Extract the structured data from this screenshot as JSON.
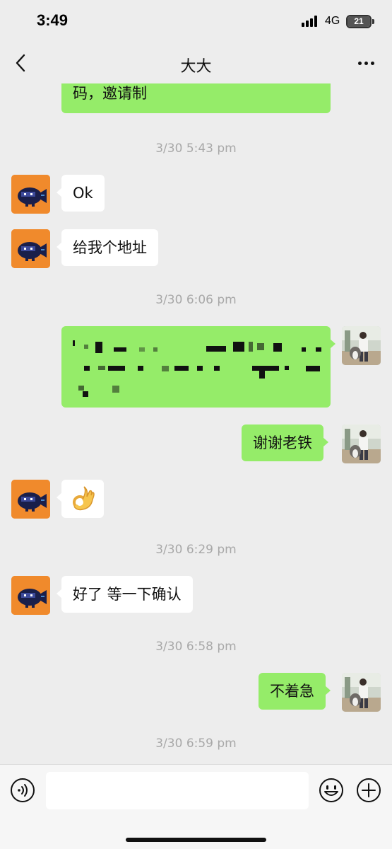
{
  "status": {
    "time": "3:49",
    "network": "4G",
    "battery": "21"
  },
  "header": {
    "title": "大大"
  },
  "messages": {
    "m1": "码，邀请制",
    "t1": "3/30 5:43 pm",
    "m2": "Ok",
    "m3": "给我个地址",
    "t2": "3/30 6:06 pm",
    "m5": "谢谢老铁",
    "t3": "3/30 6:29 pm",
    "m7": "好了 等一下确认",
    "t4": "3/30 6:58 pm",
    "m8": "不着急",
    "t5": "3/30 6:59 pm"
  },
  "input": {
    "value": ""
  },
  "icons": {
    "back": "chevron-left-icon",
    "more": "more-dots-icon",
    "voice": "voice-icon",
    "emoji": "emoji-icon",
    "plus": "plus-icon",
    "ok_emoji": "ok-hand-icon"
  },
  "colors": {
    "outgoing": "#95ec69",
    "incoming": "#ffffff",
    "background": "#ededed",
    "contact_avatar": "#f08a2c"
  }
}
